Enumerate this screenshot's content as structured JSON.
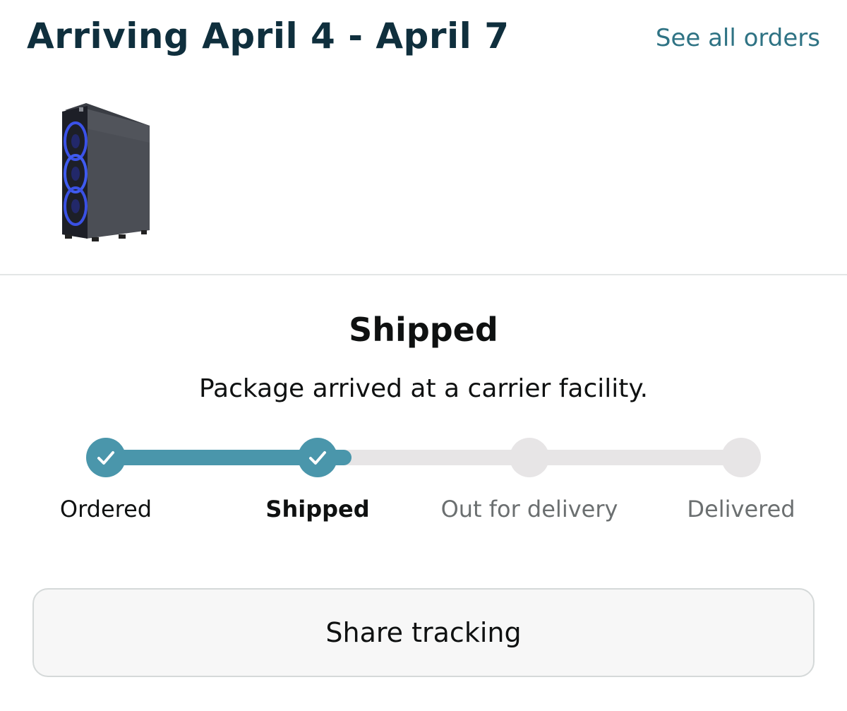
{
  "header": {
    "arrival_title": "Arriving April 4 - April 7",
    "see_all_orders": "See all orders"
  },
  "status": {
    "title": "Shipped",
    "detail": "Package arrived at a carrier facility."
  },
  "tracker": {
    "progress_fraction": 0.387,
    "steps": [
      {
        "label": "Ordered",
        "state": "done"
      },
      {
        "label": "Shipped",
        "state": "current"
      },
      {
        "label": "Out for delivery",
        "state": "pending"
      },
      {
        "label": "Delivered",
        "state": "pending"
      }
    ]
  },
  "actions": {
    "share_tracking": "Share tracking"
  },
  "colors": {
    "accent": "#4a96ab",
    "link": "#2f7384",
    "title": "#0f2f3d",
    "track_inactive": "#e7e5e6",
    "button_bg": "#f7f7f7",
    "button_border": "#d5d9d9"
  },
  "icons": {
    "check": "checkmark-icon",
    "product": "pc-tower-product-image"
  }
}
